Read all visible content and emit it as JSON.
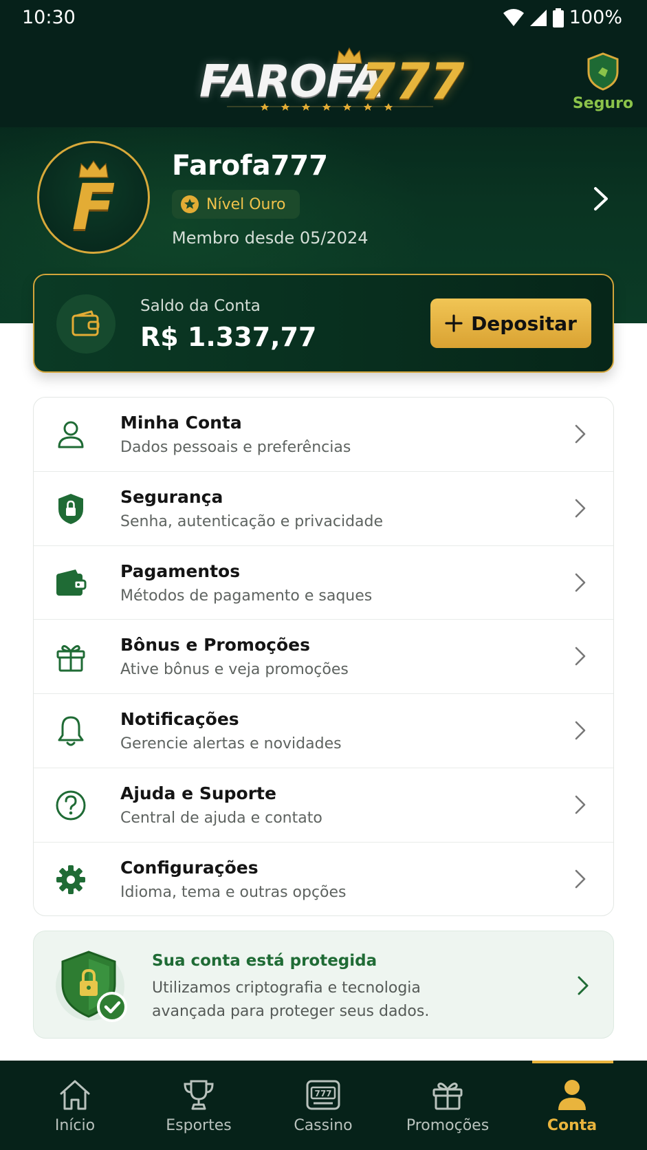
{
  "status_bar": {
    "time": "10:30",
    "battery": "100%"
  },
  "header": {
    "logo_word": "FAROFA",
    "logo_number": "777",
    "secure_label": "Seguro"
  },
  "profile": {
    "avatar_letter": "F",
    "name": "Farofa777",
    "level": "Nível Ouro",
    "member_since": "Membro desde 05/2024"
  },
  "balance": {
    "label": "Saldo da Conta",
    "value": "R$ 1.337,77",
    "deposit_label": "Depositar"
  },
  "menu": {
    "items": [
      {
        "title": "Minha Conta",
        "subtitle": "Dados pessoais e preferências",
        "icon": "user-icon"
      },
      {
        "title": "Segurança",
        "subtitle": "Senha, autenticação e privacidade",
        "icon": "shield-lock-icon"
      },
      {
        "title": "Pagamentos",
        "subtitle": "Métodos de pagamento e saques",
        "icon": "wallet-icon"
      },
      {
        "title": "Bônus e Promoções",
        "subtitle": "Ative bônus e veja promoções",
        "icon": "gift-icon"
      },
      {
        "title": "Notificações",
        "subtitle": "Gerencie alertas e novidades",
        "icon": "bell-icon"
      },
      {
        "title": "Ajuda e Suporte",
        "subtitle": "Central de ajuda e contato",
        "icon": "help-icon"
      },
      {
        "title": "Configurações",
        "subtitle": "Idioma, tema e outras opções",
        "icon": "gear-icon"
      }
    ]
  },
  "protection": {
    "title": "Sua conta está protegida",
    "description": "Utilizamos criptografia e tecnologia avançada para proteger seus dados."
  },
  "nav": {
    "items": [
      {
        "label": "Início",
        "icon": "home-icon"
      },
      {
        "label": "Esportes",
        "icon": "trophy-icon"
      },
      {
        "label": "Cassino",
        "icon": "slot-machine-icon"
      },
      {
        "label": "Promoções",
        "icon": "gift-icon"
      },
      {
        "label": "Conta",
        "icon": "user-icon",
        "active": true
      }
    ]
  },
  "colors": {
    "dark_green": "#06211a",
    "accent_gold": "#e9b43d",
    "brand_green": "#1f6b35"
  }
}
